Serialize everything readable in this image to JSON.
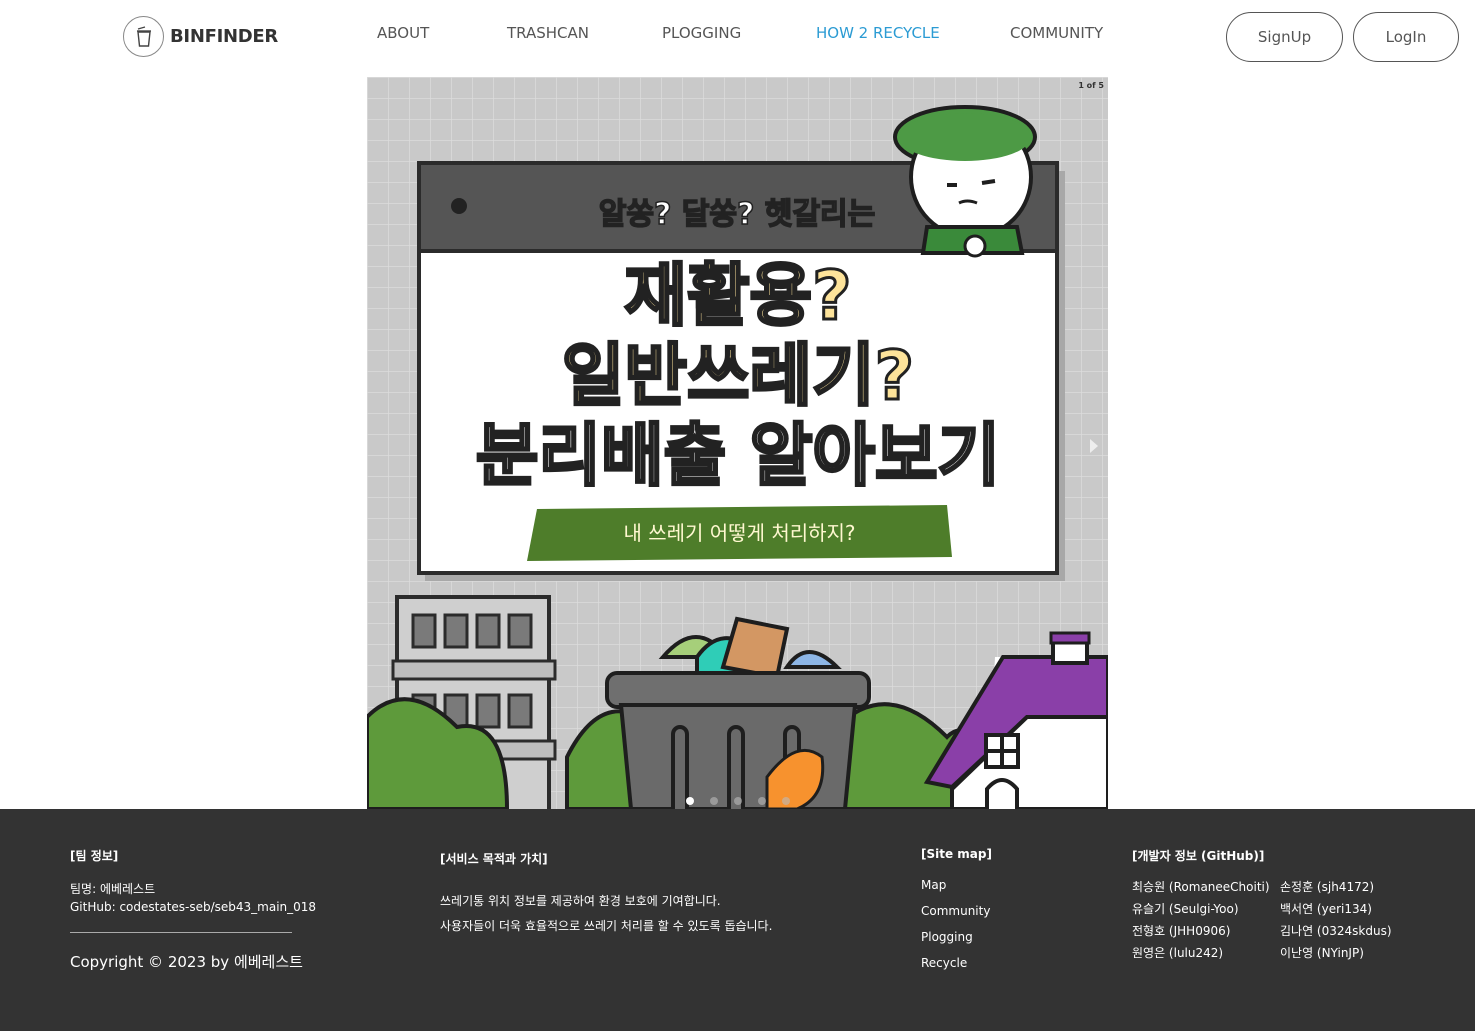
{
  "header": {
    "logo_text": "BINFINDER",
    "nav": [
      {
        "label": "ABOUT",
        "active": false
      },
      {
        "label": "TRASHCAN",
        "active": false
      },
      {
        "label": "PLOGGING",
        "active": false
      },
      {
        "label": "HOW 2 RECYCLE",
        "active": true
      },
      {
        "label": "COMMUNITY",
        "active": false
      }
    ],
    "signup_label": "SignUp",
    "login_label": "LogIn"
  },
  "slider": {
    "counter": "1 of 5",
    "current": 1,
    "total": 5,
    "slide1": {
      "top_line": "알쏭? 달쏭? 헷갈리는",
      "title_line1": "재활용?",
      "title_line2": "일반쓰레기?",
      "title_line3": "분리배출 알아보기",
      "subtitle": "내 쓰레기 어떻게 처리하지?"
    },
    "colors": {
      "bg": "#c9c9c9",
      "bush": "#5e9a3b",
      "title_yellow": "#fde39a",
      "banner_green": "#4e7d2a",
      "roof": "#8a3fa8"
    }
  },
  "footer": {
    "team": {
      "heading": "[팀 정보]",
      "name": "팀명: 에베레스트",
      "github": "GitHub: codestates-seb/seb43_main_018",
      "copyright": "Copyright © 2023 by 에베레스트"
    },
    "service": {
      "heading": "[서비스 목적과 가치]",
      "line1": "쓰레기통 위치 정보를 제공하여 환경 보호에 기여합니다.",
      "line2": "사용자들이 더욱 효율적으로 쓰레기 처리를 할 수 있도록 돕습니다."
    },
    "sitemap": {
      "heading": "[Site map]",
      "links": [
        "Map",
        "Community",
        "Plogging",
        "Recycle"
      ]
    },
    "developers": {
      "heading": "[개발자 정보 (GitHub)]",
      "list": [
        "최승원 (RomaneeChoiti)",
        "손정훈 (sjh4172)",
        "유슬기 (Seulgi-Yoo)",
        "백서연 (yeri134)",
        "전형호 (JHH0906)",
        "김나연 (0324skdus)",
        "원영은 (lulu242)",
        "이난영 (NYinJP)"
      ]
    }
  }
}
